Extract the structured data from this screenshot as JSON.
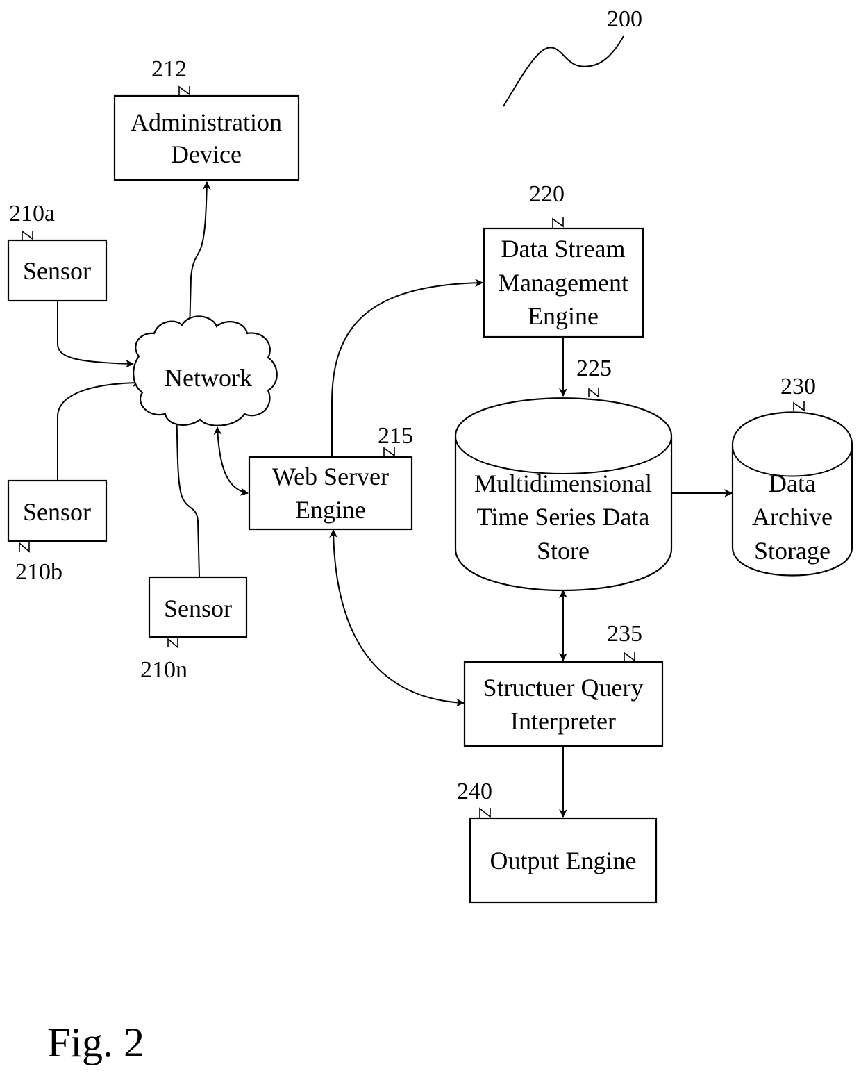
{
  "figure": {
    "caption": "Fig. 2",
    "reference": "200"
  },
  "nodes": {
    "admin": {
      "ref": "212",
      "lines": [
        "Administration",
        "Device"
      ]
    },
    "sensor_a": {
      "ref": "210a",
      "lines": [
        "Sensor"
      ]
    },
    "sensor_b": {
      "ref": "210b",
      "lines": [
        "Sensor"
      ]
    },
    "sensor_n": {
      "ref": "210n",
      "lines": [
        "Sensor"
      ]
    },
    "network": {
      "lines": [
        "Network"
      ]
    },
    "web_server": {
      "ref": "215",
      "lines": [
        "Web Server",
        "Engine"
      ]
    },
    "dsm": {
      "ref": "220",
      "lines": [
        "Data Stream",
        "Management",
        "Engine"
      ]
    },
    "tsdb": {
      "ref": "225",
      "lines": [
        "Multidimensional",
        "Time Series Data",
        "Store"
      ]
    },
    "archive": {
      "ref": "230",
      "lines": [
        "Data",
        "Archive",
        "Storage"
      ]
    },
    "query": {
      "ref": "235",
      "lines": [
        "Structuer Query",
        "Interpreter"
      ]
    },
    "output": {
      "ref": "240",
      "lines": [
        "Output Engine"
      ]
    }
  },
  "edges": [
    {
      "from": "sensor_a",
      "to": "network",
      "direction": "one-way"
    },
    {
      "from": "sensor_b",
      "to": "network",
      "direction": "one-way"
    },
    {
      "from": "sensor_n",
      "to": "network",
      "direction": "one-way"
    },
    {
      "from": "network",
      "to": "admin",
      "direction": "two-way"
    },
    {
      "from": "network",
      "to": "web_server",
      "direction": "two-way"
    },
    {
      "from": "web_server",
      "to": "dsm",
      "direction": "one-way"
    },
    {
      "from": "web_server",
      "to": "query",
      "direction": "two-way"
    },
    {
      "from": "dsm",
      "to": "tsdb",
      "direction": "one-way"
    },
    {
      "from": "tsdb",
      "to": "archive",
      "direction": "one-way"
    },
    {
      "from": "tsdb",
      "to": "query",
      "direction": "two-way"
    },
    {
      "from": "query",
      "to": "output",
      "direction": "one-way"
    }
  ]
}
